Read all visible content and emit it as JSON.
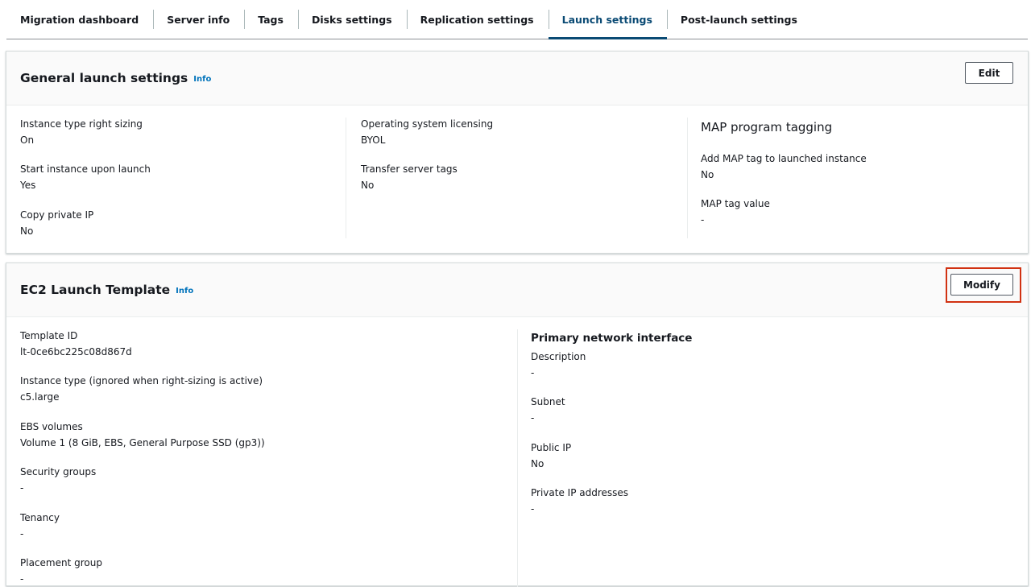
{
  "tabs": [
    {
      "label": "Migration dashboard",
      "active": false
    },
    {
      "label": "Server info",
      "active": false
    },
    {
      "label": "Tags",
      "active": false
    },
    {
      "label": "Disks settings",
      "active": false
    },
    {
      "label": "Replication settings",
      "active": false
    },
    {
      "label": "Launch settings",
      "active": true
    },
    {
      "label": "Post-launch settings",
      "active": false
    }
  ],
  "general": {
    "title": "General launch settings",
    "info": "Info",
    "edit_label": "Edit",
    "col1": [
      {
        "label": "Instance type right sizing",
        "value": "On"
      },
      {
        "label": "Start instance upon launch",
        "value": "Yes"
      },
      {
        "label": "Copy private IP",
        "value": "No"
      }
    ],
    "col2": [
      {
        "label": "Operating system licensing",
        "value": "BYOL"
      },
      {
        "label": "Transfer server tags",
        "value": "No"
      }
    ],
    "map": {
      "heading": "MAP program tagging",
      "items": [
        {
          "label": "Add MAP tag to launched instance",
          "value": "No"
        },
        {
          "label": "MAP tag value",
          "value": "-"
        }
      ]
    }
  },
  "ec2": {
    "title": "EC2 Launch Template",
    "info": "Info",
    "modify_label": "Modify",
    "col1": [
      {
        "label": "Template ID",
        "value": "lt-0ce6bc225c08d867d"
      },
      {
        "label": "Instance type (ignored when right-sizing is active)",
        "value": "c5.large"
      },
      {
        "label": "EBS volumes",
        "value": "Volume 1 (8 GiB, EBS, General Purpose SSD (gp3))"
      },
      {
        "label": "Security groups",
        "value": "-"
      },
      {
        "label": "Tenancy",
        "value": "-"
      },
      {
        "label": "Placement group",
        "value": "-"
      }
    ],
    "network": {
      "heading": "Primary network interface",
      "items": [
        {
          "label": "Description",
          "value": "-"
        },
        {
          "label": "Subnet",
          "value": "-"
        },
        {
          "label": "Public IP",
          "value": "No"
        },
        {
          "label": "Private IP addresses",
          "value": "-"
        }
      ]
    }
  },
  "colors": {
    "active_tab": "#0a4a74",
    "info_link": "#0073bb",
    "highlight": "#d13212"
  }
}
